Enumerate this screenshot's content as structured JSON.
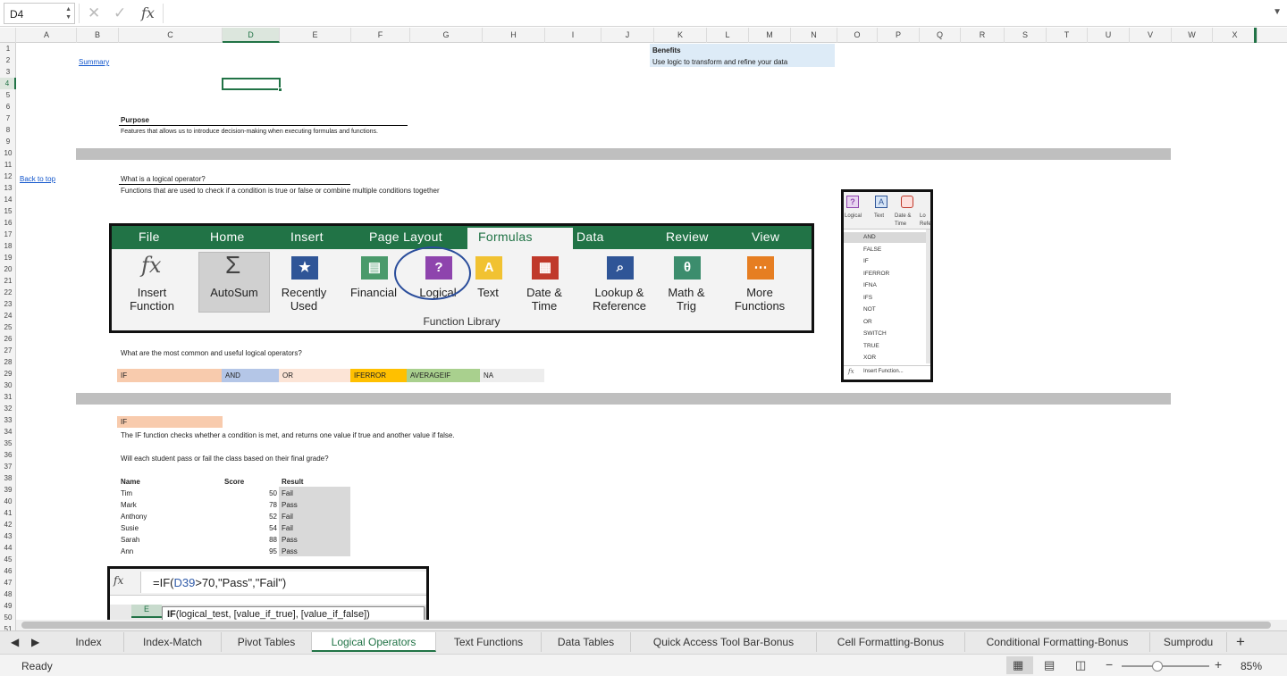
{
  "formula_bar": {
    "name_box": "D4",
    "cancel": "✕",
    "confirm": "✓",
    "fx": "fx",
    "value": ""
  },
  "columns": [
    "A",
    "B",
    "C",
    "D",
    "E",
    "F",
    "G",
    "H",
    "I",
    "J",
    "K",
    "L",
    "M",
    "N",
    "O",
    "P",
    "Q",
    "R",
    "S",
    "T",
    "U",
    "V",
    "W",
    "X"
  ],
  "rows": [
    "1",
    "2",
    "3",
    "4",
    "5",
    "6",
    "7",
    "8",
    "9",
    "10",
    "11",
    "12",
    "13",
    "14",
    "15",
    "16",
    "17",
    "18",
    "19",
    "20",
    "21",
    "22",
    "23",
    "24",
    "25",
    "26",
    "27",
    "28",
    "29",
    "30",
    "31",
    "32",
    "33",
    "34",
    "35",
    "36",
    "37",
    "38",
    "39",
    "40",
    "41",
    "42",
    "43",
    "44",
    "45",
    "46",
    "47",
    "48",
    "49",
    "50",
    "51"
  ],
  "sheet": {
    "summary_link": "Summary",
    "back_to_top": "Back to top",
    "benefits_title": "Benefits",
    "benefits_text": "Use logic to transform and refine your data",
    "purpose_title": "Purpose",
    "purpose_text": "Features that allows us to introduce decision-making when executing formulas and functions.",
    "logical_title": "What is a logical operator?",
    "logical_text": "Functions that are used to check if a condition is true or false or combine multiple conditions together",
    "common_question": "What are the most common and useful logical operators?",
    "operators": [
      {
        "label": "IF",
        "color": "#f8cbad"
      },
      {
        "label": "AND",
        "color": "#b4c6e7"
      },
      {
        "label": "OR",
        "color": "#fce4d6"
      },
      {
        "label": "IFERROR",
        "color": "#ffc000"
      },
      {
        "label": "AVERAGEIF",
        "color": "#a9d08e"
      },
      {
        "label": "NA",
        "color": "#ededed"
      }
    ],
    "if_label": "IF",
    "if_desc": "The IF function checks whether a condition is met, and returns one value if true and another value if false.",
    "question": "Will each student pass or fail the class based on their final grade?",
    "table": {
      "headers": [
        "Name",
        "Score",
        "Result"
      ],
      "rows": [
        [
          "Tim",
          "50",
          "Fail"
        ],
        [
          "Mark",
          "78",
          "Pass"
        ],
        [
          "Anthony",
          "52",
          "Fail"
        ],
        [
          "Susie",
          "54",
          "Fail"
        ],
        [
          "Sarah",
          "88",
          "Pass"
        ],
        [
          "Ann",
          "95",
          "Pass"
        ]
      ]
    }
  },
  "ribbon": {
    "tabs": [
      "File",
      "Home",
      "Insert",
      "Page Layout",
      "Formulas",
      "Data",
      "Review",
      "View"
    ],
    "active_tab": "Formulas",
    "buttons": [
      {
        "line1": "Insert",
        "line2": "Function"
      },
      {
        "line1": "AutoSum",
        "line2": ""
      },
      {
        "line1": "Recently",
        "line2": "Used"
      },
      {
        "line1": "Financial",
        "line2": ""
      },
      {
        "line1": "Logical",
        "line2": ""
      },
      {
        "line1": "Text",
        "line2": ""
      },
      {
        "line1": "Date &",
        "line2": "Time"
      },
      {
        "line1": "Lookup &",
        "line2": "Reference"
      },
      {
        "line1": "Math &",
        "line2": "Trig"
      },
      {
        "line1": "More",
        "line2": "Functions"
      }
    ],
    "group_label": "Function Library",
    "colors": {
      "green": "#217346",
      "selected_bg": "#d0d0d0",
      "circle": "#2a4d9b"
    }
  },
  "dropdown": {
    "header": [
      "Logical",
      "Text",
      "Date &",
      "Time",
      "Lo",
      "Refe"
    ],
    "items": [
      "AND",
      "FALSE",
      "IF",
      "IFERROR",
      "IFNA",
      "IFS",
      "NOT",
      "OR",
      "SWITCH",
      "TRUE",
      "XOR"
    ],
    "insert_function": "Insert Function..."
  },
  "formula_image": {
    "fx": "fx",
    "prefix": "=IF(",
    "ref": "D39",
    "rest": ">70,\"Pass\",\"Fail\")",
    "tooltip_fn": "IF",
    "tooltip_args": "(logical_test, [value_if_true], [value_if_false])",
    "behind": "E"
  },
  "tabs": [
    "Index",
    "Index-Match",
    "Pivot Tables",
    "Logical Operators",
    "Text Functions",
    "Data Tables",
    "Quick Access Tool Bar-Bonus",
    "Cell Formatting-Bonus",
    "Conditional Formatting-Bonus",
    "Sumprodu"
  ],
  "active_sheet": "Logical Operators",
  "status": {
    "ready": "Ready",
    "zoom": "85%",
    "minus": "−",
    "plus": "+"
  }
}
